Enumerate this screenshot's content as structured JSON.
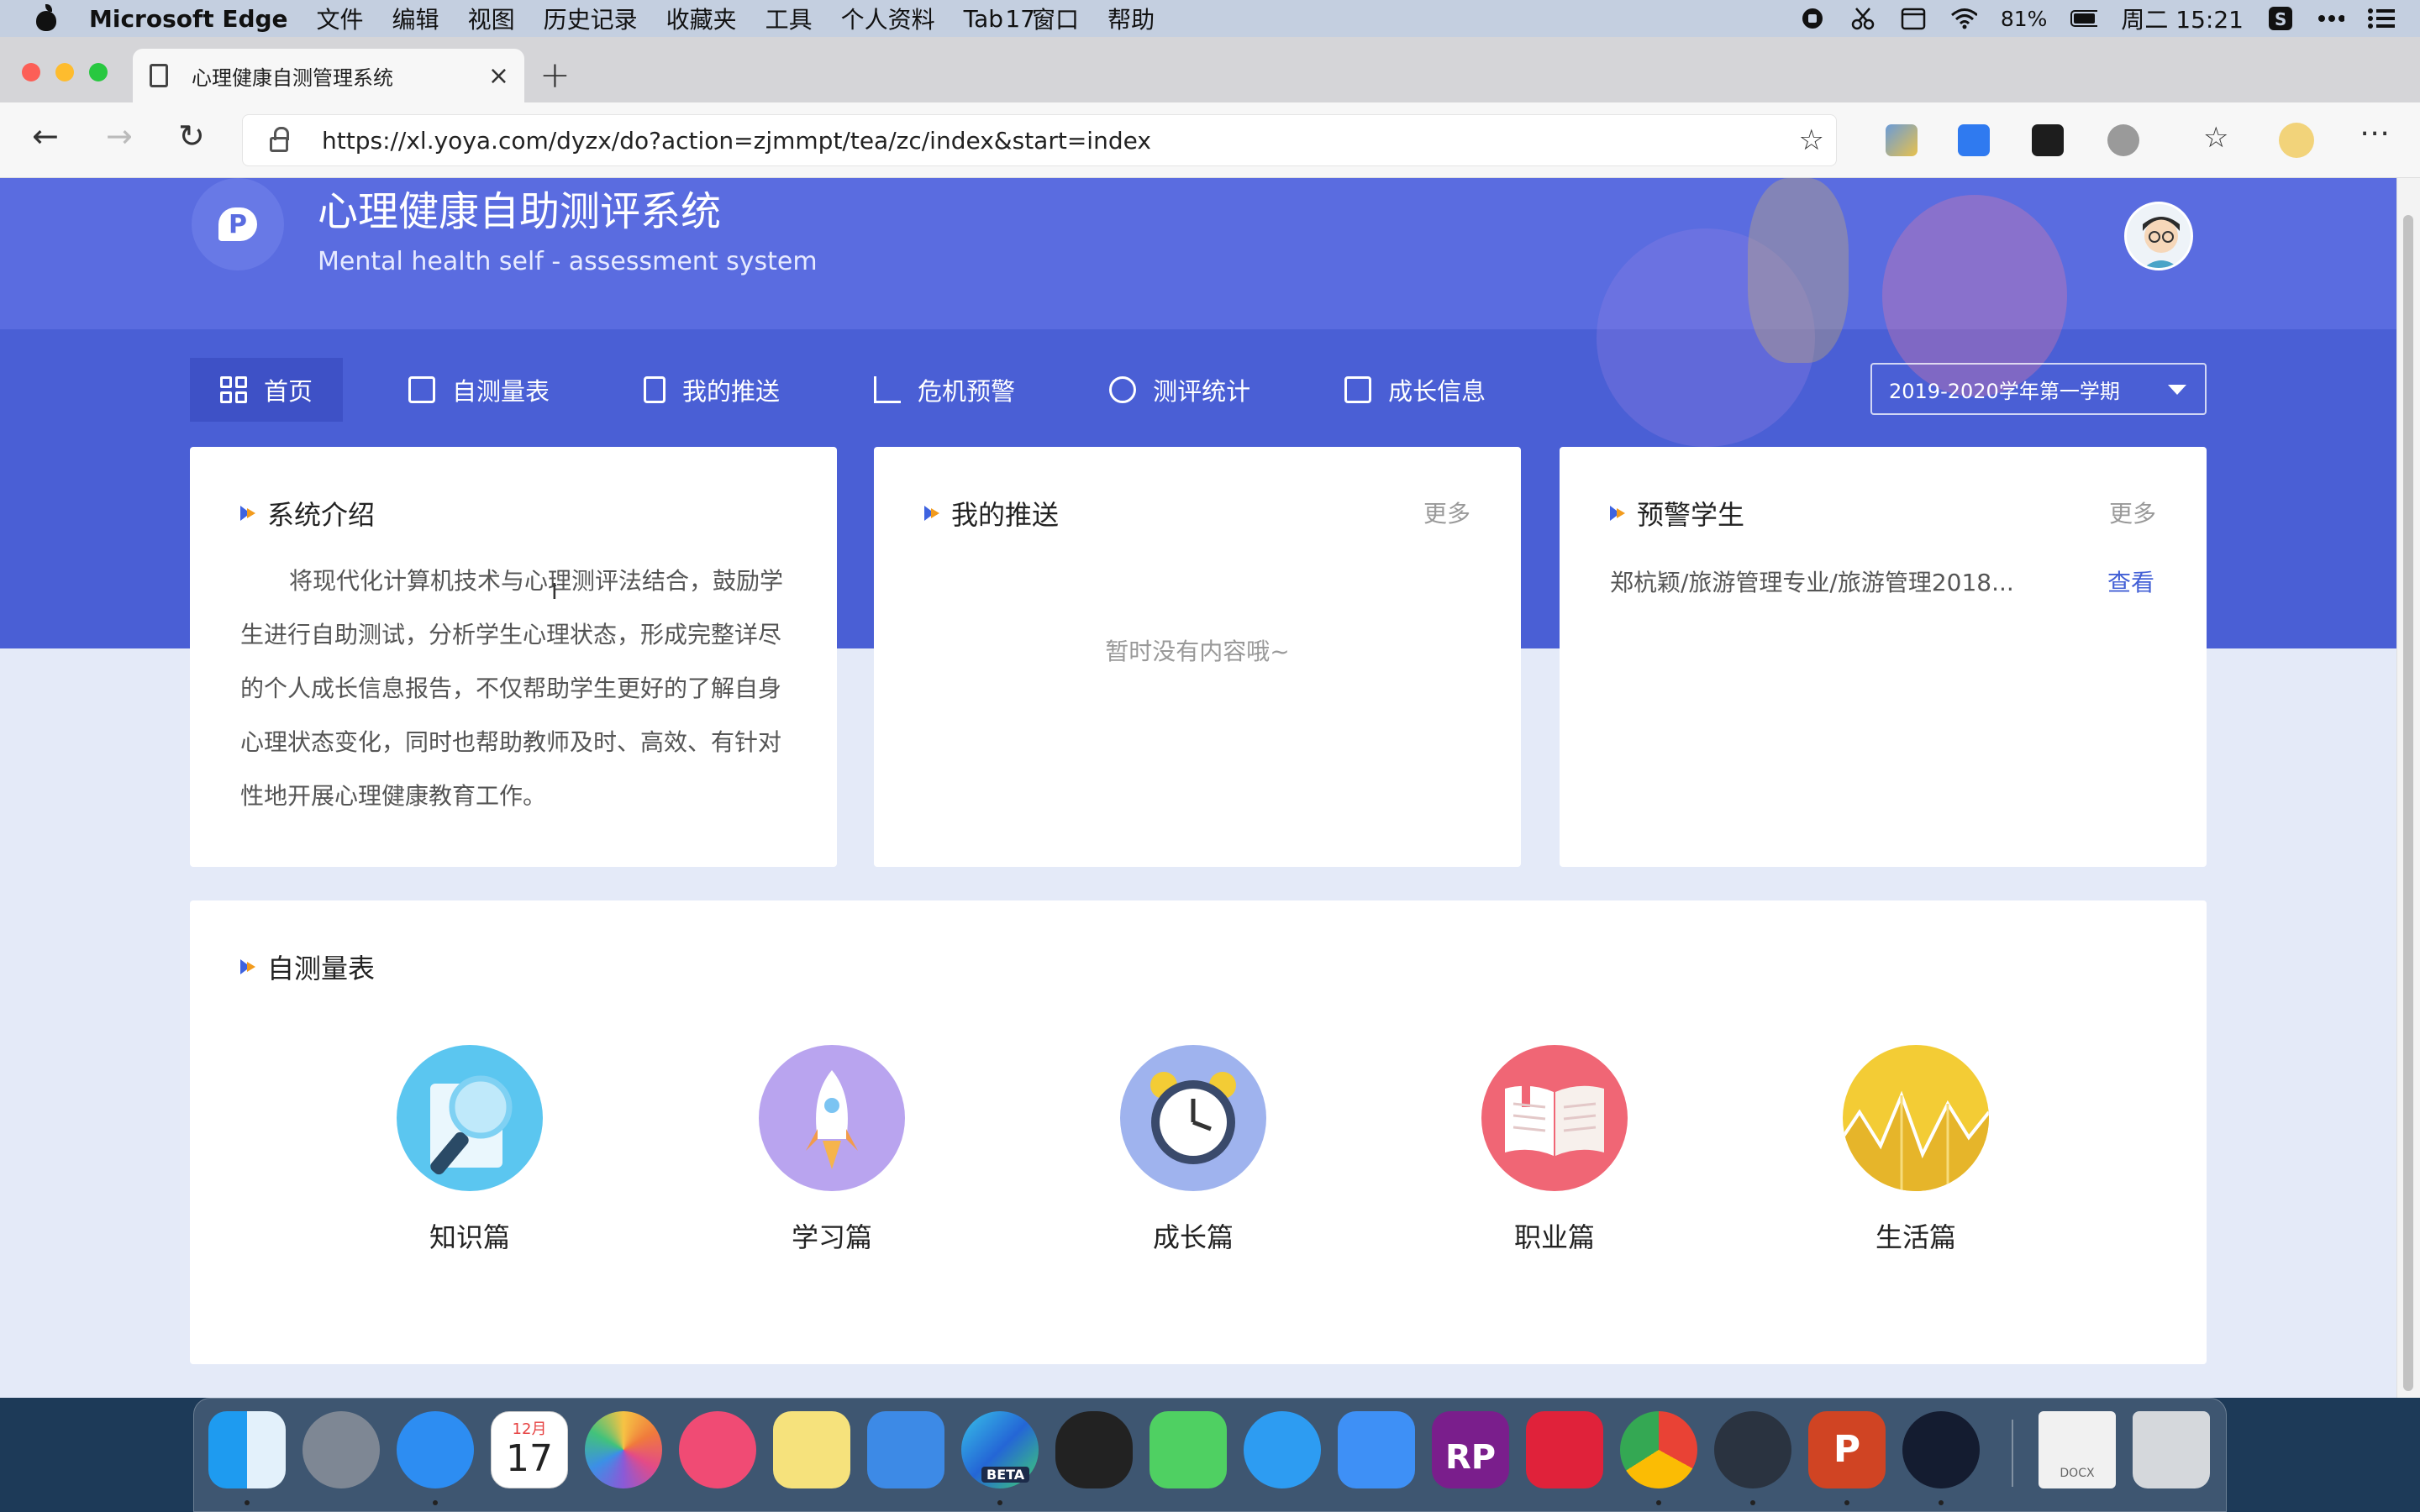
{
  "menubar": {
    "app_name": "Microsoft Edge",
    "items": [
      "文件",
      "编辑",
      "视图",
      "历史记录",
      "收藏夹",
      "工具",
      "个人资料",
      "Tab",
      "窗口",
      "帮助"
    ],
    "calendar_day": "17",
    "battery": "81%",
    "clock": "周二 15:21"
  },
  "browser": {
    "tab_title": "心理健康自测管理系统",
    "url": "https://xl.yoya.com/dyzx/do?action=zjmmpt/tea/zc/index&start=index"
  },
  "header": {
    "logo_letter": "P",
    "title": "心理健康自助测评系统",
    "subtitle": "Mental health self - assessment system"
  },
  "nav": {
    "items": [
      {
        "label": "首页",
        "icon": "grid-icon",
        "active": true
      },
      {
        "label": "自测量表",
        "icon": "calendar-icon"
      },
      {
        "label": "我的推送",
        "icon": "document-icon"
      },
      {
        "label": "危机预警",
        "icon": "line-chart-icon"
      },
      {
        "label": "测评统计",
        "icon": "pie-chart-icon"
      },
      {
        "label": "成长信息",
        "icon": "wallet-icon"
      }
    ],
    "term_select": "2019-2020学年第一学期"
  },
  "intro": {
    "title": "系统介绍",
    "text": "将现代化计算机技术与心理测评法结合，鼓励学生进行自助测试，分析学生心理状态，形成完整详尽的个人成长信息报告，不仅帮助学生更好的了解自身心理状态变化，同时也帮助教师及时、高效、有针对性地开展心理健康教育工作。"
  },
  "push": {
    "title": "我的推送",
    "more": "更多",
    "empty": "暂时没有内容哦~"
  },
  "warning": {
    "title": "预警学生",
    "more": "更多",
    "row_text": "郑杭颖/旅游管理专业/旅游管理2018...",
    "row_link": "查看"
  },
  "scales": {
    "title": "自测量表",
    "items": [
      {
        "label": "知识篇",
        "icon": "magnifier-icon",
        "color": "#5bc6f0"
      },
      {
        "label": "学习篇",
        "icon": "rocket-icon",
        "color": "#b9a4ef"
      },
      {
        "label": "成长篇",
        "icon": "alarm-clock-icon",
        "color": "#9fb3ee"
      },
      {
        "label": "职业篇",
        "icon": "book-icon",
        "color": "#f06675"
      },
      {
        "label": "生活篇",
        "icon": "wave-chart-icon",
        "color": "#f3cc35"
      }
    ]
  },
  "dock": {
    "calendar_month": "12月",
    "calendar_day": "17",
    "edge_badge": "BETA",
    "rp_label": "RP",
    "ppt_label": "P",
    "docx_label": "DOCX"
  }
}
